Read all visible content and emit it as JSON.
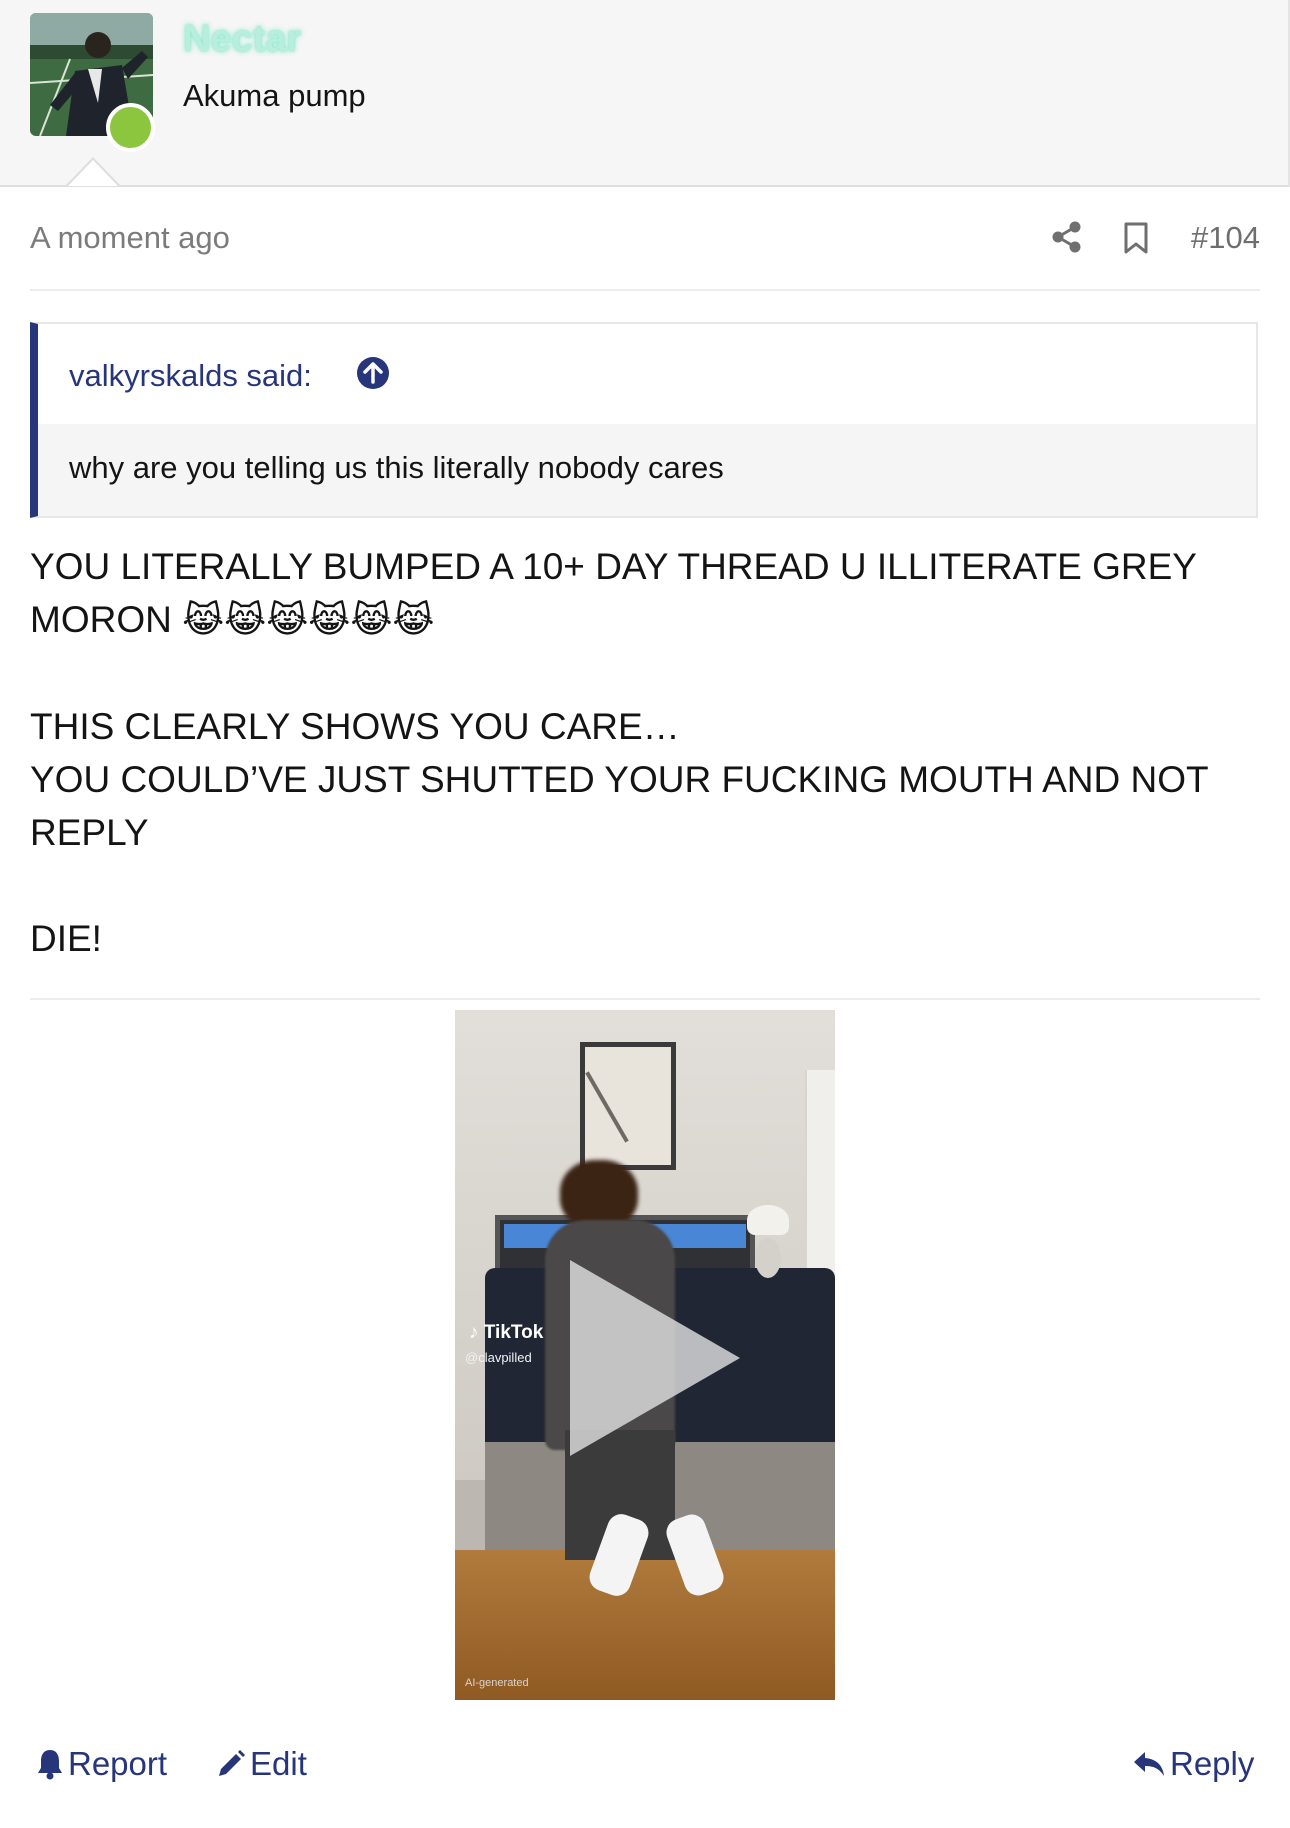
{
  "user": {
    "name": "Nectar",
    "title": "Akuma pump",
    "online": true,
    "colors": {
      "name_glow": "#b7eedc",
      "online_dot": "#8cc63f"
    }
  },
  "post": {
    "time": "A moment ago",
    "number": "#104",
    "quote": {
      "author": "valkyrskalds said:",
      "text": "why are you telling us this literally nobody cares"
    },
    "message": {
      "line1": "YOU LITERALLY BUMPED A 10+ DAY THREAD U ILLITERATE GREY MORON",
      "emoji": "😹😹😹😹😹😹",
      "line2": "THIS CLEARLY SHOWS YOU CARE…",
      "line3": "YOU COULD’VE JUST SHUTTED YOUR FUCKING MOUTH AND NOT REPLY",
      "line4": "DIE!"
    },
    "video": {
      "platform": "TikTok",
      "handle": "@clavpilled",
      "label": "AI-generated",
      "play_icon": "play-icon"
    }
  },
  "actions": {
    "report": "Report",
    "edit": "Edit",
    "reply": "Reply"
  },
  "colors": {
    "accent": "#27357a",
    "muted": "#7b7b7b"
  }
}
